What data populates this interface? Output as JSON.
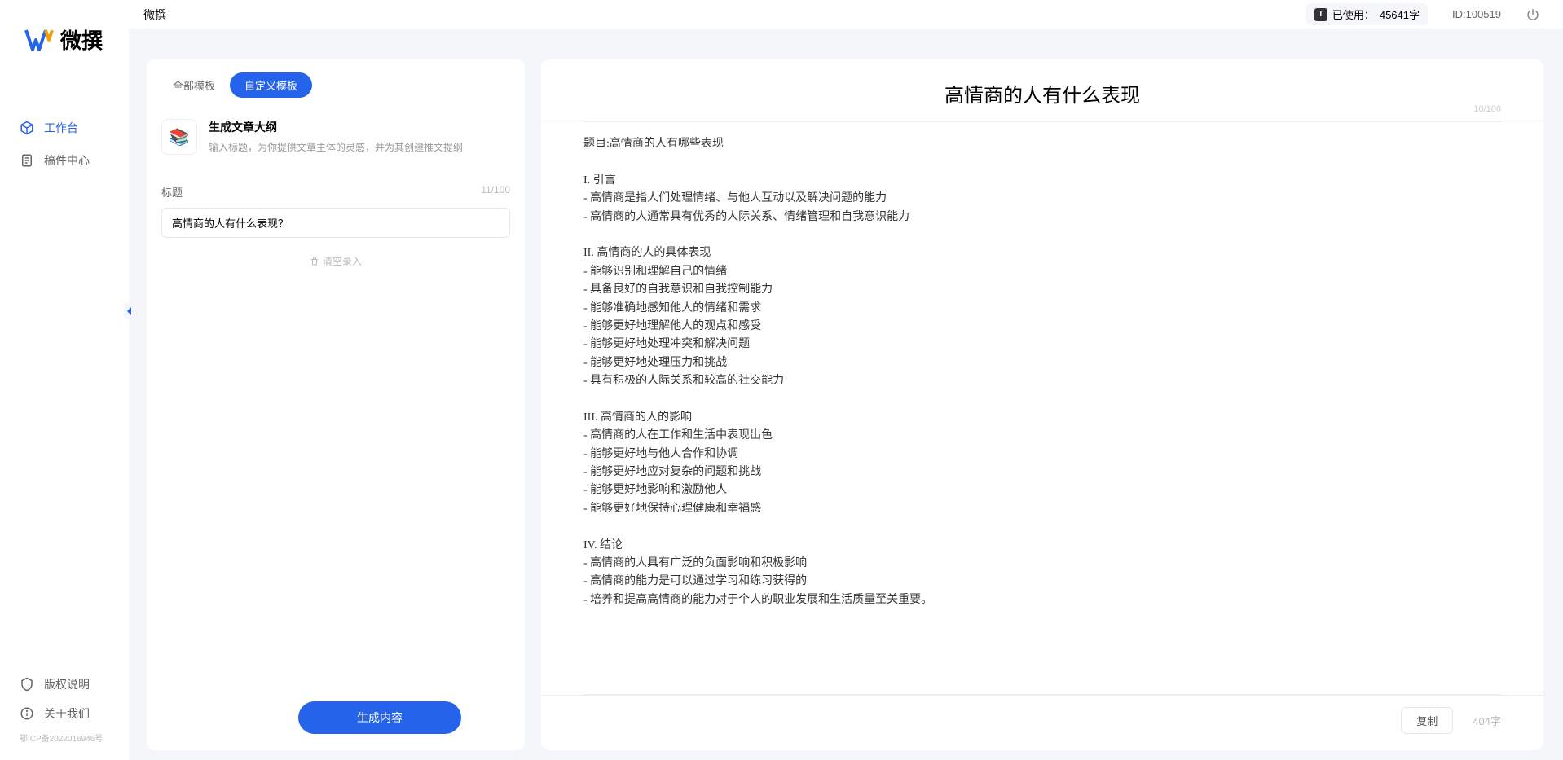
{
  "brand": {
    "name": "微撰"
  },
  "sidebar": {
    "nav": [
      {
        "label": "工作台",
        "icon": "cube-icon",
        "active": true
      },
      {
        "label": "稿件中心",
        "icon": "document-icon",
        "active": false
      }
    ],
    "footer": [
      {
        "label": "版权说明",
        "icon": "shield-icon"
      },
      {
        "label": "关于我们",
        "icon": "info-icon"
      }
    ],
    "icp": "鄂ICP备2022016946号"
  },
  "topbar": {
    "title": "微撰",
    "usage_prefix": "已使用：",
    "usage_value": "45641字",
    "user_id": "ID:100519"
  },
  "left": {
    "tabs": [
      {
        "label": "全部模板",
        "active": false
      },
      {
        "label": "自定义模板",
        "active": true
      }
    ],
    "template": {
      "title": "生成文章大纲",
      "desc": "输入标题，为你提供文章主体的灵感，并为其创建推文提纲"
    },
    "form": {
      "label": "标题",
      "counter": "11/100",
      "value": "高情商的人有什么表现？",
      "clear_label": "清空录入"
    },
    "generate_btn": "生成内容"
  },
  "output": {
    "title": "高情商的人有什么表现",
    "title_counter": "10/100",
    "body": "题目:高情商的人有哪些表现\n\nI. 引言\n- 高情商是指人们处理情绪、与他人互动以及解决问题的能力\n- 高情商的人通常具有优秀的人际关系、情绪管理和自我意识能力\n\nII. 高情商的人的具体表现\n- 能够识别和理解自己的情绪\n- 具备良好的自我意识和自我控制能力\n- 能够准确地感知他人的情绪和需求\n- 能够更好地理解他人的观点和感受\n- 能够更好地处理冲突和解决问题\n- 能够更好地处理压力和挑战\n- 具有积极的人际关系和较高的社交能力\n\nIII. 高情商的人的影响\n- 高情商的人在工作和生活中表现出色\n- 能够更好地与他人合作和协调\n- 能够更好地应对复杂的问题和挑战\n- 能够更好地影响和激励他人\n- 能够更好地保持心理健康和幸福感\n\nIV. 结论\n- 高情商的人具有广泛的负面影响和积极影响\n- 高情商的能力是可以通过学习和练习获得的\n- 培养和提高高情商的能力对于个人的职业发展和生活质量至关重要。",
    "copy_btn": "复制",
    "word_count": "404字"
  }
}
